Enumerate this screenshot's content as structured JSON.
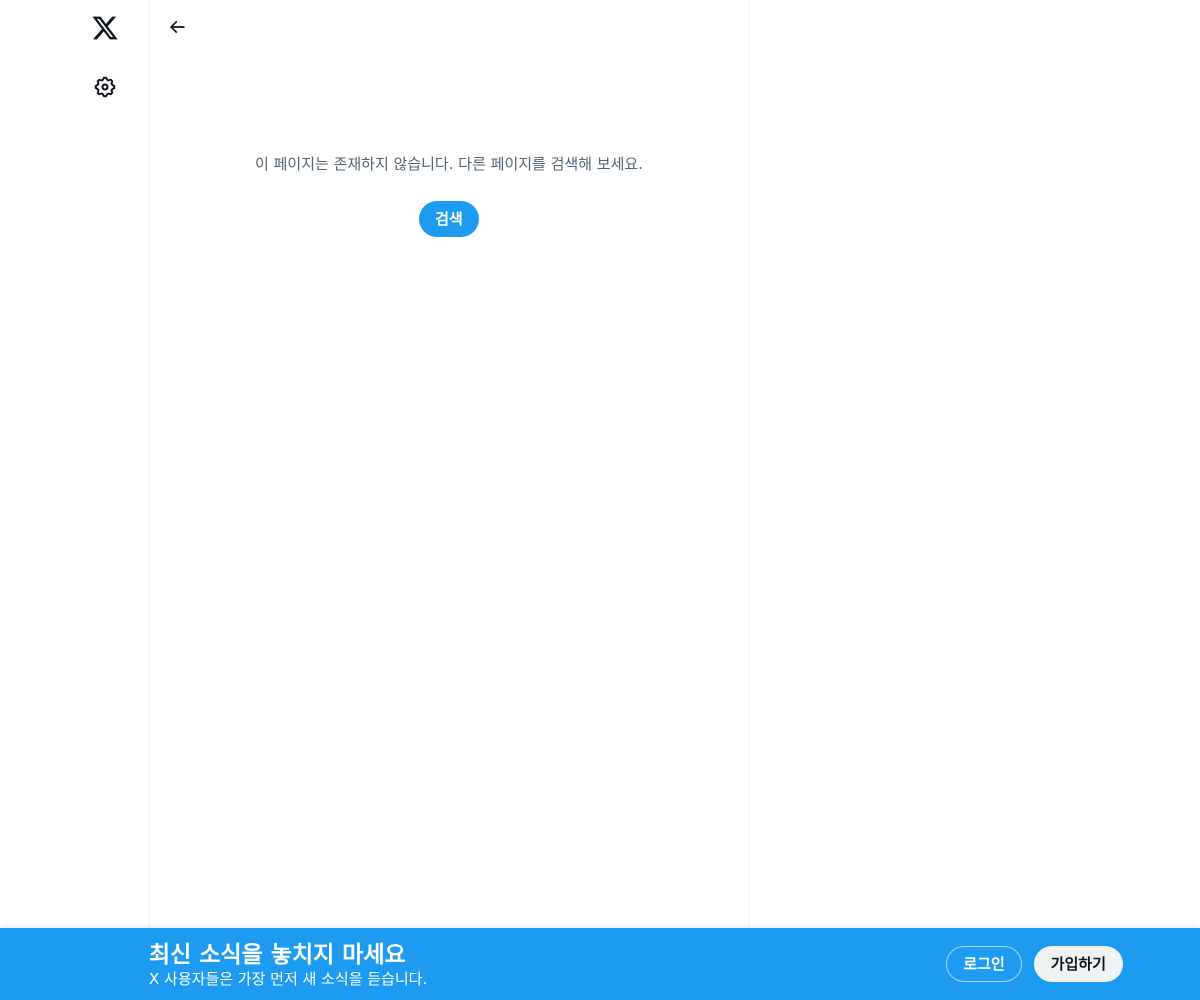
{
  "main": {
    "empty_message": "이 페이지는 존재하지 않습니다. 다른 페이지를 검색해 보세요.",
    "search_label": "검색"
  },
  "bottom_bar": {
    "title": "최신 소식을 놓치지 마세요",
    "subtitle": "X 사용자들은 가장 먼저 새 소식을 듣습니다.",
    "login_label": "로그인",
    "signup_label": "가입하기"
  },
  "icons": {
    "logo": "x-logo-icon",
    "settings": "gear-icon",
    "back": "arrow-left-icon"
  },
  "colors": {
    "accent": "#1d9bf0",
    "text_primary": "#0f1419",
    "text_secondary": "#536471",
    "border": "#eff3f4"
  }
}
